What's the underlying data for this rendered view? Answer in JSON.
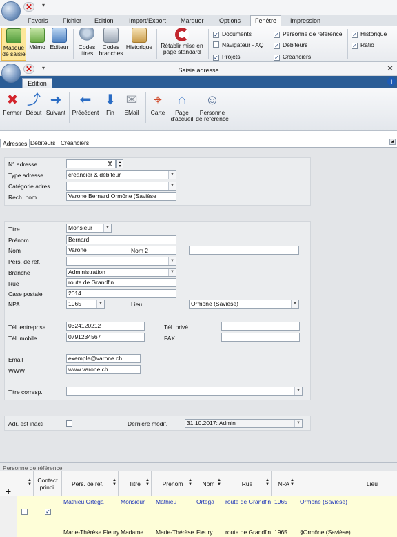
{
  "app": {
    "menu": [
      "Favoris",
      "Fichier",
      "Edition",
      "Import/Export",
      "Marquer",
      "Options",
      "Fenêtre",
      "Impression"
    ],
    "active_menu": "Fenêtre",
    "ribbon_buttons": [
      {
        "label": "Masque de saisie",
        "icon": "form-icon"
      },
      {
        "label": "Mémo",
        "icon": "memo-icon"
      },
      {
        "label": "Editeur",
        "icon": "editor-icon"
      },
      {
        "label": "Codes titres",
        "icon": "people-icon"
      },
      {
        "label": "Codes branches",
        "icon": "truck-icon"
      },
      {
        "label": "Historique",
        "icon": "history-icon"
      },
      {
        "label": "Rétablir mise en page standard",
        "icon": "reset-layout-icon"
      }
    ],
    "checks": [
      {
        "label": "Documents",
        "checked": true
      },
      {
        "label": "Navigateur - AQ",
        "checked": false
      },
      {
        "label": "Projets",
        "checked": true
      },
      {
        "label": "Personne de référence",
        "checked": true
      },
      {
        "label": "Débiteurs",
        "checked": true
      },
      {
        "label": "Créanciers",
        "checked": true
      },
      {
        "label": "Historique",
        "checked": true
      },
      {
        "label": "Ratio",
        "checked": true
      }
    ]
  },
  "dialog": {
    "title": "Saisie adresse",
    "tab": "Edition",
    "toolbar": [
      {
        "label": "Fermer",
        "icon": "close-x-icon"
      },
      {
        "label": "Début",
        "icon": "arrow-up-icon"
      },
      {
        "label": "Suivant",
        "icon": "arrow-right-icon"
      },
      {
        "label": "Précédent",
        "icon": "arrow-left-icon"
      },
      {
        "label": "Fin",
        "icon": "arrow-down-icon"
      },
      {
        "label": "EMail",
        "icon": "email-icon"
      },
      {
        "label": "Carte",
        "icon": "map-icon"
      },
      {
        "label": "Page d'accueil",
        "icon": "home-icon"
      },
      {
        "label": "Personne de référence",
        "icon": "contact-persons-icon"
      }
    ]
  },
  "form": {
    "tabs": [
      "Adresses",
      "Debiteurs",
      "Créanciers"
    ],
    "labels": {
      "no_adresse": "N° adresse",
      "type_adresse": "Type adresse",
      "categorie": "Catégorie adres",
      "rech_nom": "Rech. nom",
      "titre": "Titre",
      "prenom": "Prénom",
      "nom": "Nom",
      "nom2": "Nom 2",
      "pers_ref": "Pers. de réf.",
      "branche": "Branche",
      "rue": "Rue",
      "case_postale": "Case postale",
      "npa": "NPA",
      "lieu": "Lieu",
      "tel_entreprise": "Tél. entreprise",
      "tel_prive": "Tél. privé",
      "tel_mobile": "Tél. mobile",
      "fax": "FAX",
      "email": "Email",
      "www": "WWW",
      "titre_corresp": "Titre corresp.",
      "adr_inactif": "Adr. est inacti",
      "derniere_modif": "Dernière modif."
    },
    "values": {
      "no_adresse": "",
      "type_adresse": "créancier & débiteur",
      "categorie": "",
      "rech_nom": "Varone Bernard Ormône (Savièse",
      "titre": "Monsieur",
      "prenom": "Bernard",
      "nom": "Varone",
      "nom2": "",
      "pers_ref": "",
      "branche": "Administration",
      "rue": "route de Grandfin",
      "case_postale": "2014",
      "npa": "1965",
      "lieu": "Ormône (Savièse)",
      "tel_entreprise": "0324120212",
      "tel_prive": "",
      "tel_mobile": "0791234567",
      "fax": "",
      "email": "exemple@varone.ch",
      "www": "www.varone.ch",
      "titre_corresp": "",
      "derniere_modif": "31.10.2017: Admin"
    }
  },
  "grid": {
    "title": "Personne de référence",
    "columns": [
      "Contact princi.",
      "Pers. de réf.",
      "Titre",
      "Prénom",
      "Nom",
      "Rue",
      "NPA",
      "Lieu"
    ],
    "add_symbol": "+",
    "rows": [
      {
        "pers": "Mathieu Ortega",
        "titre": "Monsieur",
        "prenom": "Mathieu",
        "nom": "Ortega",
        "rue": "route de Grandfin",
        "npa": "1965",
        "lieu": "Ormône (Savièse)",
        "contact": true
      },
      {
        "pers": "Marie-Thérèse Fleury",
        "titre": "Madame",
        "prenom": "Marie-Thérèse",
        "nom": "Fleury",
        "rue": "route de Grandfin",
        "npa": "1965",
        "lieu": "§Ormône (Savièse)",
        "contact": false
      }
    ]
  }
}
